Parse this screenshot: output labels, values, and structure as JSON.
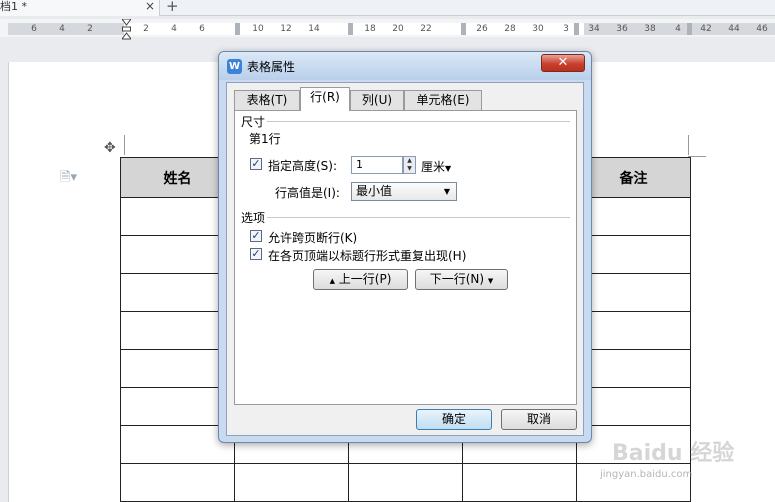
{
  "doc_tab": {
    "title": "档1 *",
    "close": "×",
    "new_tab": "+"
  },
  "ruler": {
    "ticks": [
      "6",
      "4",
      "2",
      "2",
      "4",
      "6",
      "10",
      "12",
      "14",
      "18",
      "20",
      "22",
      "26",
      "28",
      "30",
      "3",
      "34",
      "36",
      "38",
      "4",
      "42",
      "44",
      "46"
    ]
  },
  "table": {
    "header": [
      "姓名",
      "",
      "",
      "",
      "备注"
    ],
    "body_rows": 8
  },
  "watermark": {
    "brand": "Baidu 经验",
    "url": "jingyan.baidu.com"
  },
  "dialog": {
    "title": "表格属性",
    "close_label": "✕",
    "tabs": [
      {
        "label": "表格(T)",
        "active": false
      },
      {
        "label": "行(R)",
        "active": true
      },
      {
        "label": "列(U)",
        "active": false
      },
      {
        "label": "单元格(E)",
        "active": false
      }
    ],
    "size_section": "尺寸",
    "row_label": "第1行",
    "specify_height": {
      "label": "指定高度(S):",
      "checked": true
    },
    "height_value": "1",
    "unit": "厘米",
    "row_height_is_label": "行高值是(I):",
    "row_height_rule": "最小值",
    "options_section": "选项",
    "allow_break": {
      "label": "允许跨页断行(K)",
      "checked": true
    },
    "repeat_header": {
      "label": "在各页顶端以标题行形式重复出现(H)",
      "checked": true
    },
    "prev_row": "上一行(P)",
    "next_row": "下一行(N)",
    "ok": "确定",
    "cancel": "取消"
  }
}
